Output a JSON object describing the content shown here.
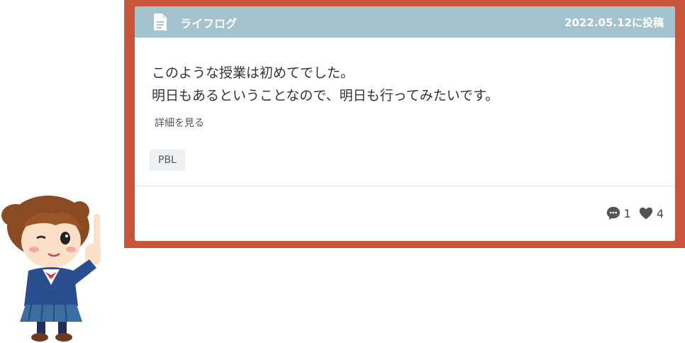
{
  "post": {
    "category": "ライフログ",
    "date": "2022.05.12に投稿",
    "lines": [
      "このような授業は初めてでした。",
      "明日もあるということなので、明日も行ってみたいです。"
    ],
    "detail_link": "詳細を見る",
    "tag": "PBL",
    "comments": "1",
    "likes": "4"
  },
  "icons": {
    "category": "document-icon",
    "comment": "comment-icon",
    "like": "heart-icon"
  },
  "colors": {
    "frame": "#c8553a",
    "header": "#a3c3cf"
  }
}
